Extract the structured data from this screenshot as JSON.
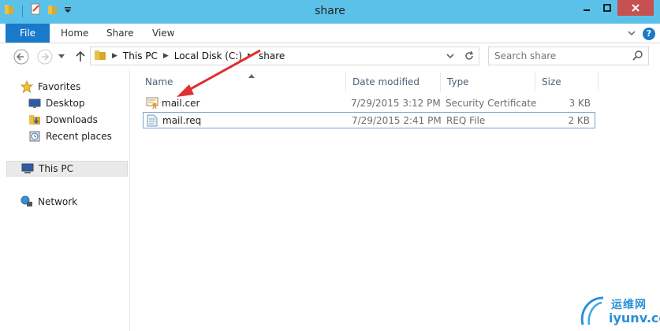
{
  "window": {
    "title": "share"
  },
  "ribbon": {
    "tabs": [
      "File",
      "Home",
      "Share",
      "View"
    ]
  },
  "address": {
    "segments": [
      "This PC",
      "Local Disk (C:)",
      "share"
    ]
  },
  "search": {
    "placeholder": "Search share"
  },
  "nav": {
    "favorites": "Favorites",
    "desktop": "Desktop",
    "downloads": "Downloads",
    "recent": "Recent places",
    "this_pc": "This PC",
    "network": "Network"
  },
  "columns": {
    "name": "Name",
    "date": "Date modified",
    "type": "Type",
    "size": "Size"
  },
  "files": [
    {
      "name": "mail.cer",
      "date": "7/29/2015 3:12 PM",
      "type": "Security Certificate",
      "size": "3 KB"
    },
    {
      "name": "mail.req",
      "date": "7/29/2015 2:41 PM",
      "type": "REQ File",
      "size": "2 KB"
    }
  ],
  "watermark": {
    "line1": "运维网",
    "line2": "iyunv.com"
  },
  "colors": {
    "titlebar": "#5cc1e8",
    "file_tab": "#1979ca",
    "close": "#c75050",
    "annotation_arrow": "#e03030"
  },
  "icons": [
    "folder-icon",
    "properties-icon",
    "new-folder-icon",
    "back-icon",
    "forward-icon",
    "up-icon",
    "refresh-icon",
    "search-icon",
    "star-icon",
    "desktop-icon",
    "downloads-icon",
    "recent-places-icon",
    "computer-icon",
    "network-icon",
    "certificate-icon",
    "document-icon"
  ]
}
